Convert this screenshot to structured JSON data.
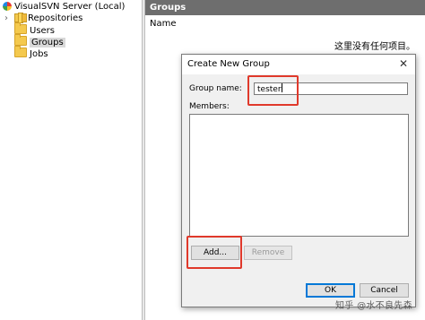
{
  "tree": {
    "root": "VisualSVN Server (Local)",
    "expand_glyph": "›",
    "items": [
      {
        "label": "Repositories",
        "icon": "repositories-icon"
      },
      {
        "label": "Users",
        "icon": "folder-icon"
      },
      {
        "label": "Groups",
        "icon": "folder-icon",
        "selected": true
      },
      {
        "label": "Jobs",
        "icon": "folder-icon"
      }
    ]
  },
  "pane": {
    "header": "Groups",
    "column": "Name",
    "empty_message": "这里没有任何项目。"
  },
  "dialog": {
    "title": "Create New Group",
    "close_glyph": "✕",
    "group_name_label": "Group name:",
    "group_name_value": "tester",
    "members_label": "Members:",
    "add_label": "Add...",
    "remove_label": "Remove",
    "ok_label": "OK",
    "cancel_label": "Cancel"
  },
  "watermark": "知乎 @水不良先森",
  "colors": {
    "header_bg": "#6e6e6e",
    "highlight": "#e0392b",
    "focus": "#0078d7"
  }
}
